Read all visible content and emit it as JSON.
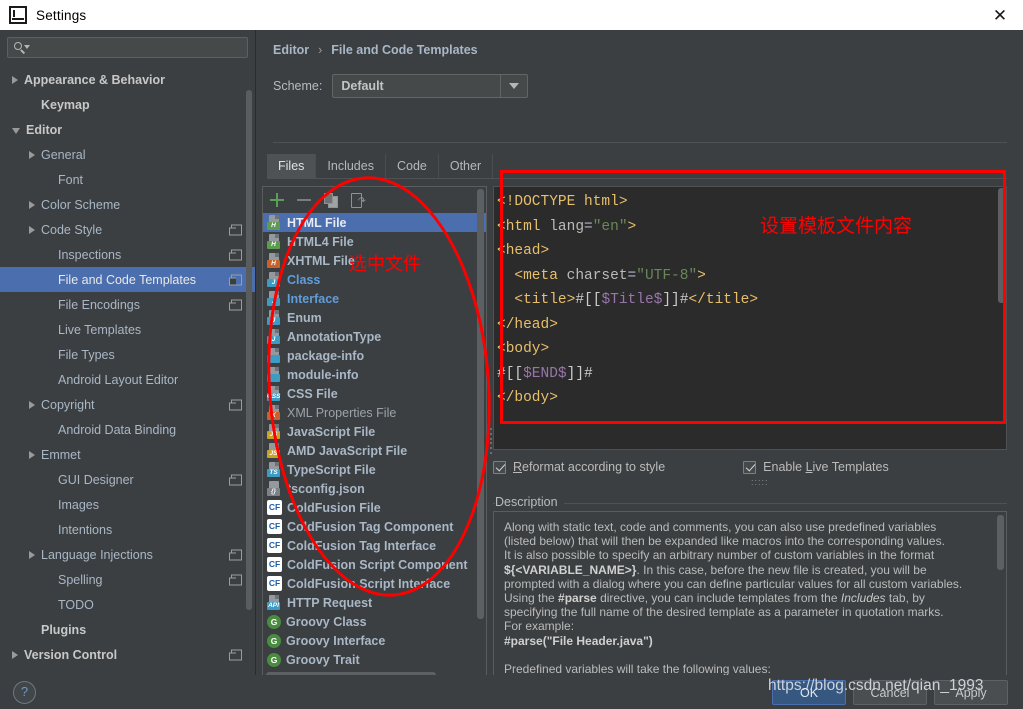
{
  "window": {
    "title": "Settings",
    "app_icon": "intellij-idea-icon",
    "close_icon": "close-icon"
  },
  "sidebar": {
    "search": {
      "placeholder": "",
      "value": "",
      "icon": "search-icon"
    },
    "items": [
      {
        "label": "Appearance & Behavior",
        "arrow": "right",
        "indent": 0,
        "bold": true,
        "badge": false
      },
      {
        "label": "Keymap",
        "arrow": "none",
        "indent": 1,
        "bold": true,
        "badge": false
      },
      {
        "label": "Editor",
        "arrow": "down",
        "indent": 0,
        "bold": true,
        "badge": false
      },
      {
        "label": "General",
        "arrow": "right",
        "indent": 1,
        "bold": false,
        "badge": false
      },
      {
        "label": "Font",
        "arrow": "none",
        "indent": 2,
        "bold": false,
        "badge": false
      },
      {
        "label": "Color Scheme",
        "arrow": "right",
        "indent": 1,
        "bold": false,
        "badge": false
      },
      {
        "label": "Code Style",
        "arrow": "right",
        "indent": 1,
        "bold": false,
        "badge": true
      },
      {
        "label": "Inspections",
        "arrow": "none",
        "indent": 2,
        "bold": false,
        "badge": true
      },
      {
        "label": "File and Code Templates",
        "arrow": "none",
        "indent": 2,
        "bold": false,
        "badge": true,
        "selected": true
      },
      {
        "label": "File Encodings",
        "arrow": "none",
        "indent": 2,
        "bold": false,
        "badge": true
      },
      {
        "label": "Live Templates",
        "arrow": "none",
        "indent": 2,
        "bold": false,
        "badge": false
      },
      {
        "label": "File Types",
        "arrow": "none",
        "indent": 2,
        "bold": false,
        "badge": false
      },
      {
        "label": "Android Layout Editor",
        "arrow": "none",
        "indent": 2,
        "bold": false,
        "badge": false
      },
      {
        "label": "Copyright",
        "arrow": "right",
        "indent": 1,
        "bold": false,
        "badge": true
      },
      {
        "label": "Android Data Binding",
        "arrow": "none",
        "indent": 2,
        "bold": false,
        "badge": false
      },
      {
        "label": "Emmet",
        "arrow": "right",
        "indent": 1,
        "bold": false,
        "badge": false
      },
      {
        "label": "GUI Designer",
        "arrow": "none",
        "indent": 2,
        "bold": false,
        "badge": true
      },
      {
        "label": "Images",
        "arrow": "none",
        "indent": 2,
        "bold": false,
        "badge": false
      },
      {
        "label": "Intentions",
        "arrow": "none",
        "indent": 2,
        "bold": false,
        "badge": false
      },
      {
        "label": "Language Injections",
        "arrow": "right",
        "indent": 1,
        "bold": false,
        "badge": true
      },
      {
        "label": "Spelling",
        "arrow": "none",
        "indent": 2,
        "bold": false,
        "badge": true
      },
      {
        "label": "TODO",
        "arrow": "none",
        "indent": 2,
        "bold": false,
        "badge": false
      },
      {
        "label": "Plugins",
        "arrow": "none",
        "indent": 1,
        "bold": true,
        "badge": false
      },
      {
        "label": "Version Control",
        "arrow": "right",
        "indent": 0,
        "bold": true,
        "badge": true
      }
    ]
  },
  "breadcrumb": {
    "parent": "Editor",
    "separator": "›",
    "current": "File and Code Templates"
  },
  "scheme": {
    "label": "Scheme:",
    "value": "Default",
    "dropdown_icon": "chevron-down-icon"
  },
  "tabs": [
    {
      "label": "Files",
      "active": true
    },
    {
      "label": "Includes",
      "active": false
    },
    {
      "label": "Code",
      "active": false
    },
    {
      "label": "Other",
      "active": false
    }
  ],
  "list_toolbar": [
    {
      "name": "add-template-button",
      "icon": "plus-icon"
    },
    {
      "name": "remove-template-button",
      "icon": "minus-icon"
    },
    {
      "name": "copy-template-button",
      "icon": "copy-icon"
    },
    {
      "name": "reset-template-button",
      "icon": "reset-file-icon"
    }
  ],
  "file_list": [
    {
      "label": "HTML File",
      "icon": "html-file-icon",
      "tag": "H",
      "tag_color": "#5d9c4e",
      "selected": true
    },
    {
      "label": "HTML4 File",
      "icon": "html4-file-icon",
      "tag": "H",
      "tag_color": "#5d9c4e"
    },
    {
      "label": "XHTML File",
      "icon": "xhtml-file-icon",
      "tag": "H",
      "tag_color": "#c9622a"
    },
    {
      "label": "Class",
      "icon": "java-class-icon",
      "tag": "J",
      "tag_color": "#3d9bc4",
      "style": "blue"
    },
    {
      "label": "Interface",
      "icon": "java-interface-icon",
      "tag": "J",
      "tag_color": "#3d9bc4",
      "style": "blue"
    },
    {
      "label": "Enum",
      "icon": "java-enum-icon",
      "tag": "J",
      "tag_color": "#3d9bc4"
    },
    {
      "label": "AnnotationType",
      "icon": "java-annotation-icon",
      "tag": "J",
      "tag_color": "#3d9bc4"
    },
    {
      "label": "package-info",
      "icon": "package-info-icon",
      "tag": "",
      "tag_color": "#3d9bc4"
    },
    {
      "label": "module-info",
      "icon": "module-info-icon",
      "tag": "",
      "tag_color": "#3d9bc4"
    },
    {
      "label": "CSS File",
      "icon": "css-file-icon",
      "tag": "CSS",
      "tag_color": "#3d9bc4"
    },
    {
      "label": "XML Properties File",
      "icon": "xml-properties-icon",
      "tag": "X",
      "tag_color": "#c9622a",
      "style": "dim"
    },
    {
      "label": "JavaScript File",
      "icon": "javascript-file-icon",
      "tag": "JS",
      "tag_color": "#c9a227"
    },
    {
      "label": "AMD JavaScript File",
      "icon": "amd-javascript-icon",
      "tag": "JS",
      "tag_color": "#c9a227"
    },
    {
      "label": "TypeScript File",
      "icon": "typescript-file-icon",
      "tag": "TS",
      "tag_color": "#3d9bc4"
    },
    {
      "label": "tsconfig.json",
      "icon": "tsconfig-json-icon",
      "tag": "{}",
      "tag_color": "#7d8287"
    },
    {
      "label": "ColdFusion File",
      "icon": "coldfusion-file-icon",
      "tag": "CF",
      "tag_color": "#ffffff",
      "kind": "cf"
    },
    {
      "label": "ColdFusion Tag Component",
      "icon": "coldfusion-tag-component-icon",
      "tag": "CF",
      "tag_color": "#ffffff",
      "kind": "cf"
    },
    {
      "label": "ColdFusion Tag Interface",
      "icon": "coldfusion-tag-interface-icon",
      "tag": "CF",
      "tag_color": "#ffffff",
      "kind": "cf"
    },
    {
      "label": "ColdFusion Script Component",
      "icon": "coldfusion-script-component-icon",
      "tag": "CF",
      "tag_color": "#ffffff",
      "kind": "cf"
    },
    {
      "label": "ColdFusion Script Interface",
      "icon": "coldfusion-script-interface-icon",
      "tag": "CF",
      "tag_color": "#ffffff",
      "kind": "cf"
    },
    {
      "label": "HTTP Request",
      "icon": "http-request-icon",
      "tag": "API",
      "tag_color": "#3d9bc4"
    },
    {
      "label": "Groovy Class",
      "icon": "groovy-class-icon",
      "tag": "G",
      "tag_color": "#4a8c3f",
      "kind": "groovy"
    },
    {
      "label": "Groovy Interface",
      "icon": "groovy-interface-icon",
      "tag": "G",
      "tag_color": "#4a8c3f",
      "kind": "groovy"
    },
    {
      "label": "Groovy Trait",
      "icon": "groovy-trait-icon",
      "tag": "G",
      "tag_color": "#4a8c3f",
      "kind": "groovy"
    }
  ],
  "editor": {
    "lines": [
      [
        {
          "t": "<",
          "c": "tag"
        },
        {
          "t": "!DOCTYPE html",
          "c": "doctype"
        },
        {
          "t": ">",
          "c": "tag"
        }
      ],
      [
        {
          "t": "<html ",
          "c": "tag"
        },
        {
          "t": "lang",
          "c": "attr"
        },
        {
          "t": "=",
          "c": "plain"
        },
        {
          "t": "\"en\"",
          "c": "str"
        },
        {
          "t": ">",
          "c": "tag"
        }
      ],
      [
        {
          "t": "<head>",
          "c": "tag"
        }
      ],
      [
        {
          "t": "  <meta ",
          "c": "tag"
        },
        {
          "t": "charset",
          "c": "attr"
        },
        {
          "t": "=",
          "c": "plain"
        },
        {
          "t": "\"UTF-8\"",
          "c": "str"
        },
        {
          "t": ">",
          "c": "tag"
        }
      ],
      [
        {
          "t": "  <title>",
          "c": "tag"
        },
        {
          "t": "#[[",
          "c": "hash"
        },
        {
          "t": "$Title$",
          "c": "var"
        },
        {
          "t": "]]#",
          "c": "hash"
        },
        {
          "t": "</title>",
          "c": "tag"
        }
      ],
      [
        {
          "t": "</head>",
          "c": "tag"
        }
      ],
      [
        {
          "t": "<body>",
          "c": "tag"
        }
      ],
      [
        {
          "t": "#[[",
          "c": "hash"
        },
        {
          "t": "$END$",
          "c": "var"
        },
        {
          "t": "]]#",
          "c": "hash"
        }
      ],
      [
        {
          "t": "</body>",
          "c": "tag"
        }
      ]
    ]
  },
  "options": [
    {
      "label": "Reformat according to style",
      "mnemonic": "R",
      "checked": true,
      "name": "reformat-according-to-style-checkbox"
    },
    {
      "label": "Enable Live Templates",
      "mnemonic": "L",
      "checked": true,
      "name": "enable-live-templates-checkbox"
    }
  ],
  "description": {
    "title": "Description",
    "paragraphs": [
      "Along with static text, code and comments, you can also use predefined variables",
      "(listed below) that will then be expanded like macros into the corresponding values.",
      "It is also possible to specify an arbitrary number of custom variables in the format",
      "${<VARIABLE_NAME>}. In this case, before the new file is created, you will be",
      "prompted with a dialog where you can define particular values for all custom variables.",
      "Using the #parse directive, you can include templates from the Includes tab, by",
      "specifying the full name of the desired template as a parameter in quotation marks.",
      "For example:",
      "#parse(\"File Header.java\")",
      "",
      "Predefined variables will take the following values:"
    ]
  },
  "annotations": [
    {
      "text": "选中文件",
      "color": "#ff0000",
      "name": "annotation-select-file"
    },
    {
      "text": "设置模板文件内容",
      "color": "#ff0000",
      "name": "annotation-template-content"
    }
  ],
  "footer": {
    "help_icon": "help-icon",
    "buttons": [
      {
        "label": "OK",
        "primary": true,
        "name": "ok-button"
      },
      {
        "label": "Cancel",
        "primary": false,
        "name": "cancel-button"
      },
      {
        "label": "Apply",
        "primary": false,
        "name": "apply-button"
      }
    ]
  },
  "watermark": {
    "text": "https://blog.csdn.net/qian_1993"
  }
}
